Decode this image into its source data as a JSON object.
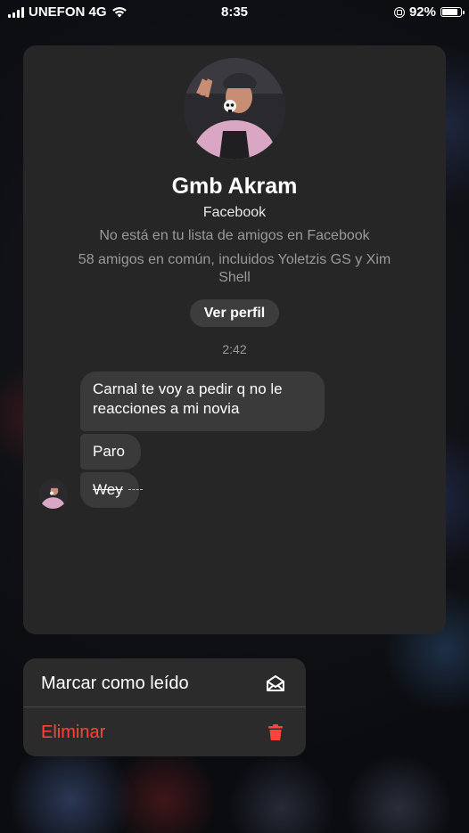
{
  "status_bar": {
    "carrier": "UNEFON 4G",
    "time": "8:35",
    "battery_percent": "92%",
    "battery_level": 0.92
  },
  "profile": {
    "name": "Gmb Akram",
    "source": "Facebook",
    "note": "No está en tu lista de amigos en Facebook",
    "mutual_friends": "58 amigos en común, incluidos Yoletzis GS y Xim Shell",
    "view_profile_label": "Ver perfil"
  },
  "conversation": {
    "timestamp": "2:42",
    "messages": [
      {
        "text": "Carnal te voy a pedir q no le reacciones a mi novia"
      },
      {
        "text": "Paro"
      },
      {
        "text": "Wey",
        "unsent": true
      }
    ]
  },
  "context_menu": {
    "items": [
      {
        "label": "Marcar como leído",
        "icon": "envelope-open-icon"
      },
      {
        "label": "Eliminar",
        "icon": "trash-icon",
        "color": "#ff453a"
      }
    ]
  },
  "colors": {
    "card_bg": "#262626",
    "bubble_bg": "#3a3a3a",
    "menu_bg": "#2b2b2b",
    "destructive": "#ff453a"
  }
}
